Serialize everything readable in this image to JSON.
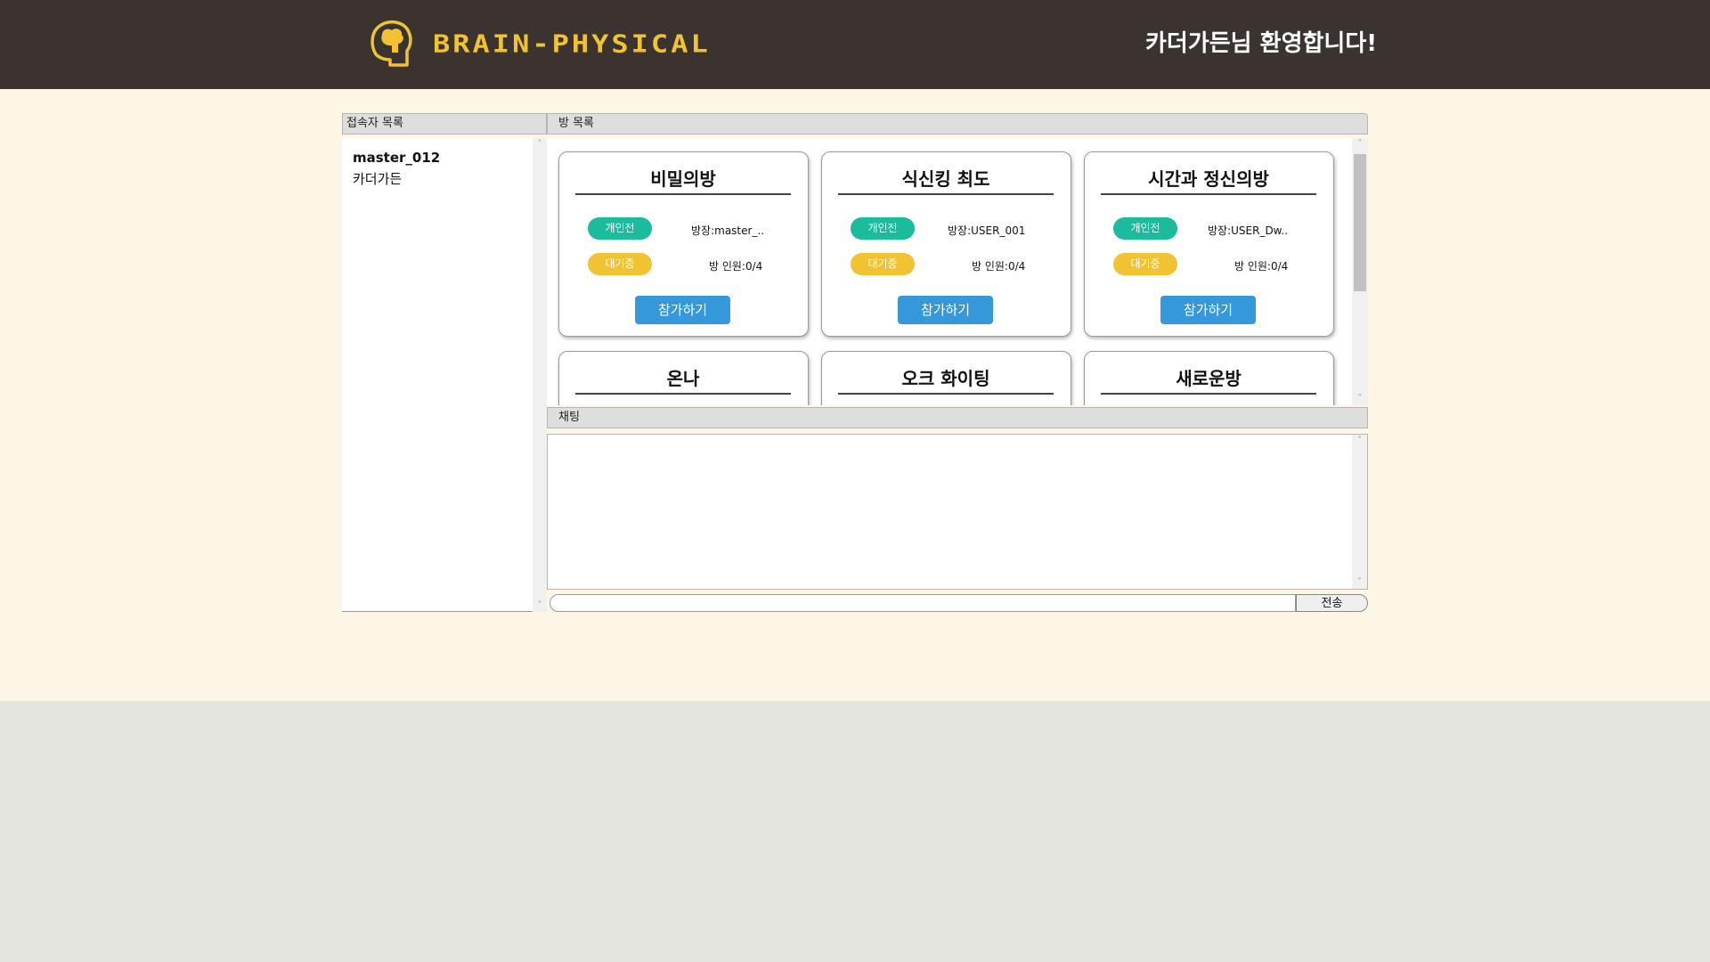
{
  "header": {
    "logo_text": "BRAIN-PHYSICAL",
    "welcome": "카더가든님 환영합니다!"
  },
  "users_panel": {
    "title": "접속자 목록",
    "users": [
      "master_012",
      "카더가든"
    ]
  },
  "rooms_panel": {
    "title": "방 목록",
    "join_label": "참가하기",
    "rooms": [
      {
        "title": "비밀의방",
        "mode": "개인전",
        "state": "대기중",
        "owner": "방장:master_..",
        "count": "방 인원:0/4"
      },
      {
        "title": "식신킹 최도",
        "mode": "개인전",
        "state": "대기중",
        "owner": "방장:USER_001",
        "count": "방 인원:0/4"
      },
      {
        "title": "시간과 정신의방",
        "mode": "개인전",
        "state": "대기중",
        "owner": "방장:USER_Dw..",
        "count": "방 인원:0/4"
      },
      {
        "title": "온나"
      },
      {
        "title": "오크 화이팅"
      },
      {
        "title": "새로운방"
      }
    ]
  },
  "chat_panel": {
    "title": "채팅",
    "input_value": "",
    "send_label": "전송"
  },
  "colors": {
    "header_bg": "#3b3330",
    "logo": "#f1c232",
    "page_bg": "#fdf5e6",
    "mode_pill": "#1abc9c",
    "state_pill": "#f1c232",
    "join_button": "#3498db"
  }
}
